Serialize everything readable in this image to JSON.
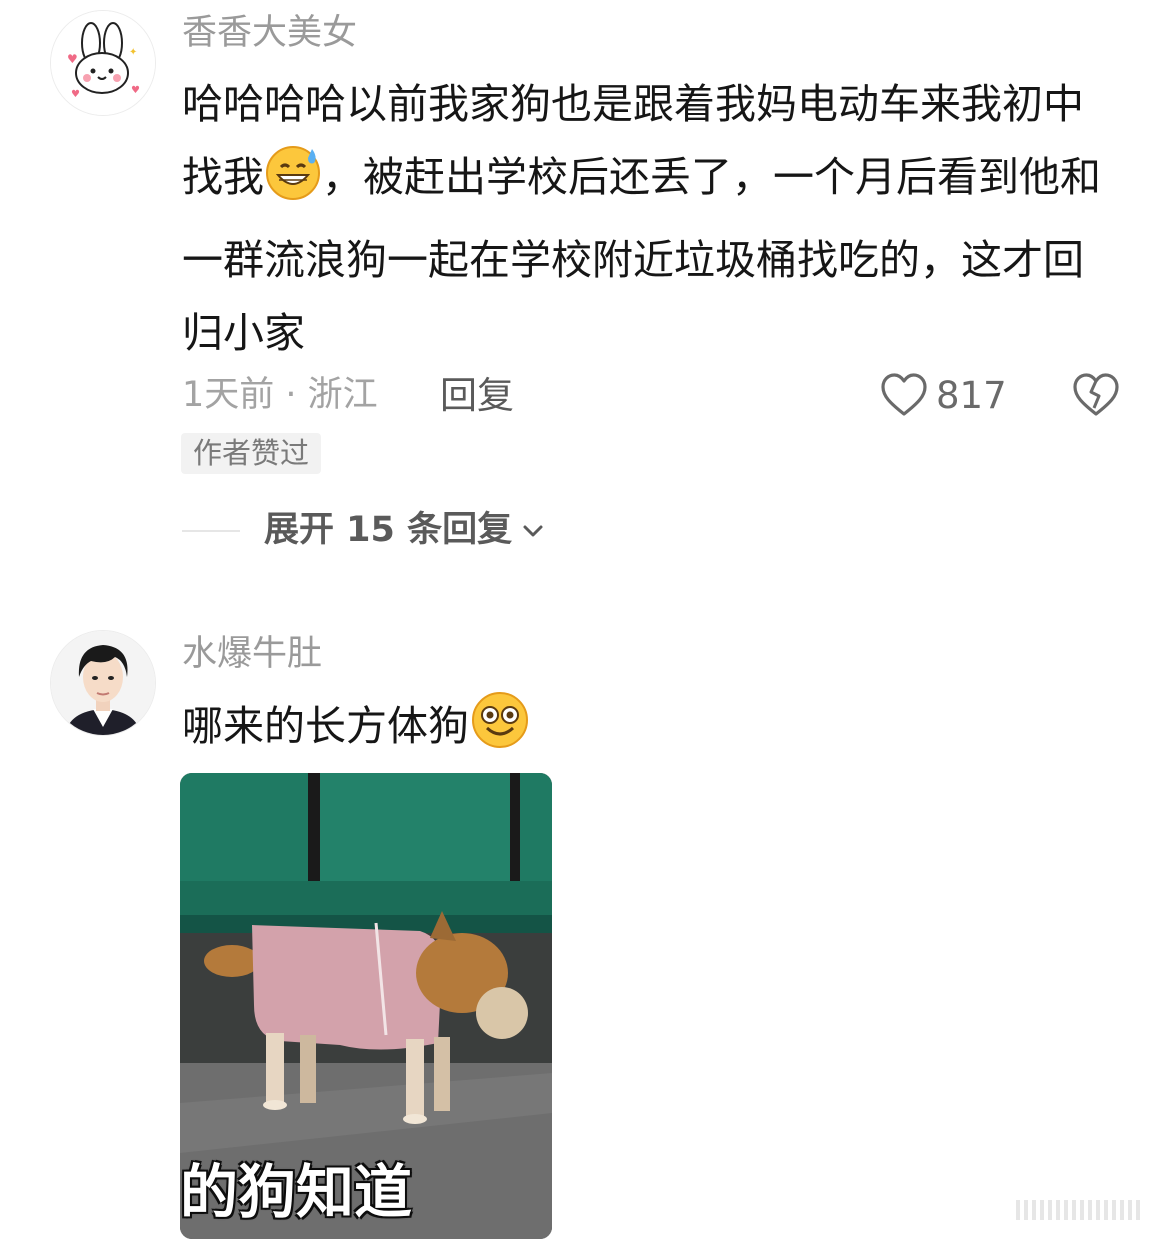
{
  "comments": [
    {
      "username": "香香大美女",
      "text_part1": "哈哈哈哈以前我家狗也是跟着我妈电动车来我初中找我",
      "text_part2": "，被赶出学校后还丢了，一个月后看到他和一群流浪狗一起在学校附近垃圾桶找吃的，这才回归小家",
      "meta": "1天前 · 浙江",
      "reply_label": "回复",
      "likes": "817",
      "badge": "作者赞过",
      "expand_label": "展开 15 条回复"
    },
    {
      "username": "水爆牛肚",
      "text": "哪来的长方体狗",
      "image_caption": "的狗知道"
    }
  ],
  "colors": {
    "seat": "#1f7a63",
    "floor": "#6e6e6e",
    "sweater": "#d3a2ab",
    "dog_fur": "#b47a3b"
  }
}
